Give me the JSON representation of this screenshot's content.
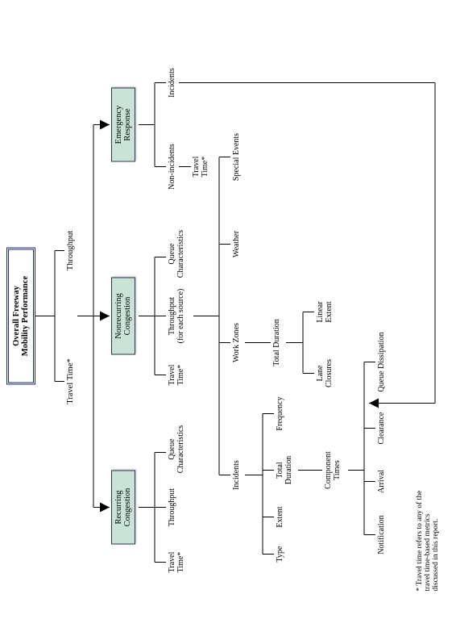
{
  "title": {
    "line1": "Overall Freeway",
    "line2": "Mobility Performance"
  },
  "top": {
    "travel_time": "Travel Time*",
    "throughput": "Throughput"
  },
  "nodes": {
    "recurring": {
      "line1": "Recurring",
      "line2": "Congestion"
    },
    "nonrecurring": {
      "line1": "Nonrecurring",
      "line2": "Congestion"
    },
    "emergency": {
      "line1": "Emergency",
      "line2": "Response"
    }
  },
  "recurring_children": {
    "travel_time": {
      "line1": "Travel",
      "line2": "Time*"
    },
    "throughput": "Throughput",
    "queue": {
      "line1": "Queue",
      "line2": "Characteristics"
    }
  },
  "nonrecurring_children": {
    "travel_time": {
      "line1": "Travel",
      "line2": "Time*"
    },
    "throughput": {
      "line1": "Throughput",
      "line2": "(for each source)"
    },
    "queue": {
      "line1": "Queue",
      "line2": "Characteristics"
    }
  },
  "emergency_children": {
    "non_incidents": "Non-incidents",
    "incidents": "Incidents",
    "travel_time": {
      "line1": "Travel",
      "line2": "Time*"
    }
  },
  "sources": {
    "incidents": "Incidents",
    "work_zones": "Work Zones",
    "weather": "Weather",
    "special_events": "Special Events"
  },
  "incident_metrics": {
    "type": "Type",
    "extent": "Extent",
    "total_duration": {
      "line1": "Total",
      "line2": "Duration"
    },
    "frequency": "Frequency",
    "component_times": {
      "line1": "Component",
      "line2": "Times"
    }
  },
  "component_steps": {
    "notification": "Notification",
    "arrival": "Arrival",
    "clearance": "Clearance",
    "queue_dissipation": "Queue Dissipation"
  },
  "workzone_metrics": {
    "total_duration": "Total Duration",
    "lane_closures": {
      "line1": "Lane",
      "line2": "Closures"
    },
    "linear_extent": {
      "line1": "Linear",
      "line2": "Extent"
    }
  },
  "footnote": {
    "line1": "*  Travel time refers to any of the",
    "line2": "    travel time-based metrics",
    "line3": "    discussed in this report."
  }
}
